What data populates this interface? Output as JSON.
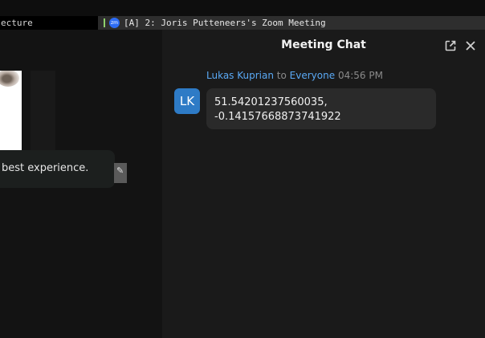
{
  "taskbar": {
    "left_window_label": "ecture",
    "active_window_title": "[A] 2: Joris Putteneers's Zoom Meeting",
    "app_icon_text": "zm"
  },
  "stage": {
    "notice_text": "best experience."
  },
  "chat": {
    "title": "Meeting Chat",
    "messages": [
      {
        "avatar_initials": "LK",
        "sender": "Lukas Kuprian",
        "to_word": "to",
        "recipient": "Everyone",
        "time": "04:56 PM",
        "text": "51.54201237560035,\n-0.14157668873741922"
      }
    ]
  },
  "colors": {
    "accent_blue": "#5aa9f5",
    "avatar_blue": "#2e7bc6",
    "panel_bg": "#1a1a1a",
    "bubble_bg": "#2a2a2a"
  }
}
